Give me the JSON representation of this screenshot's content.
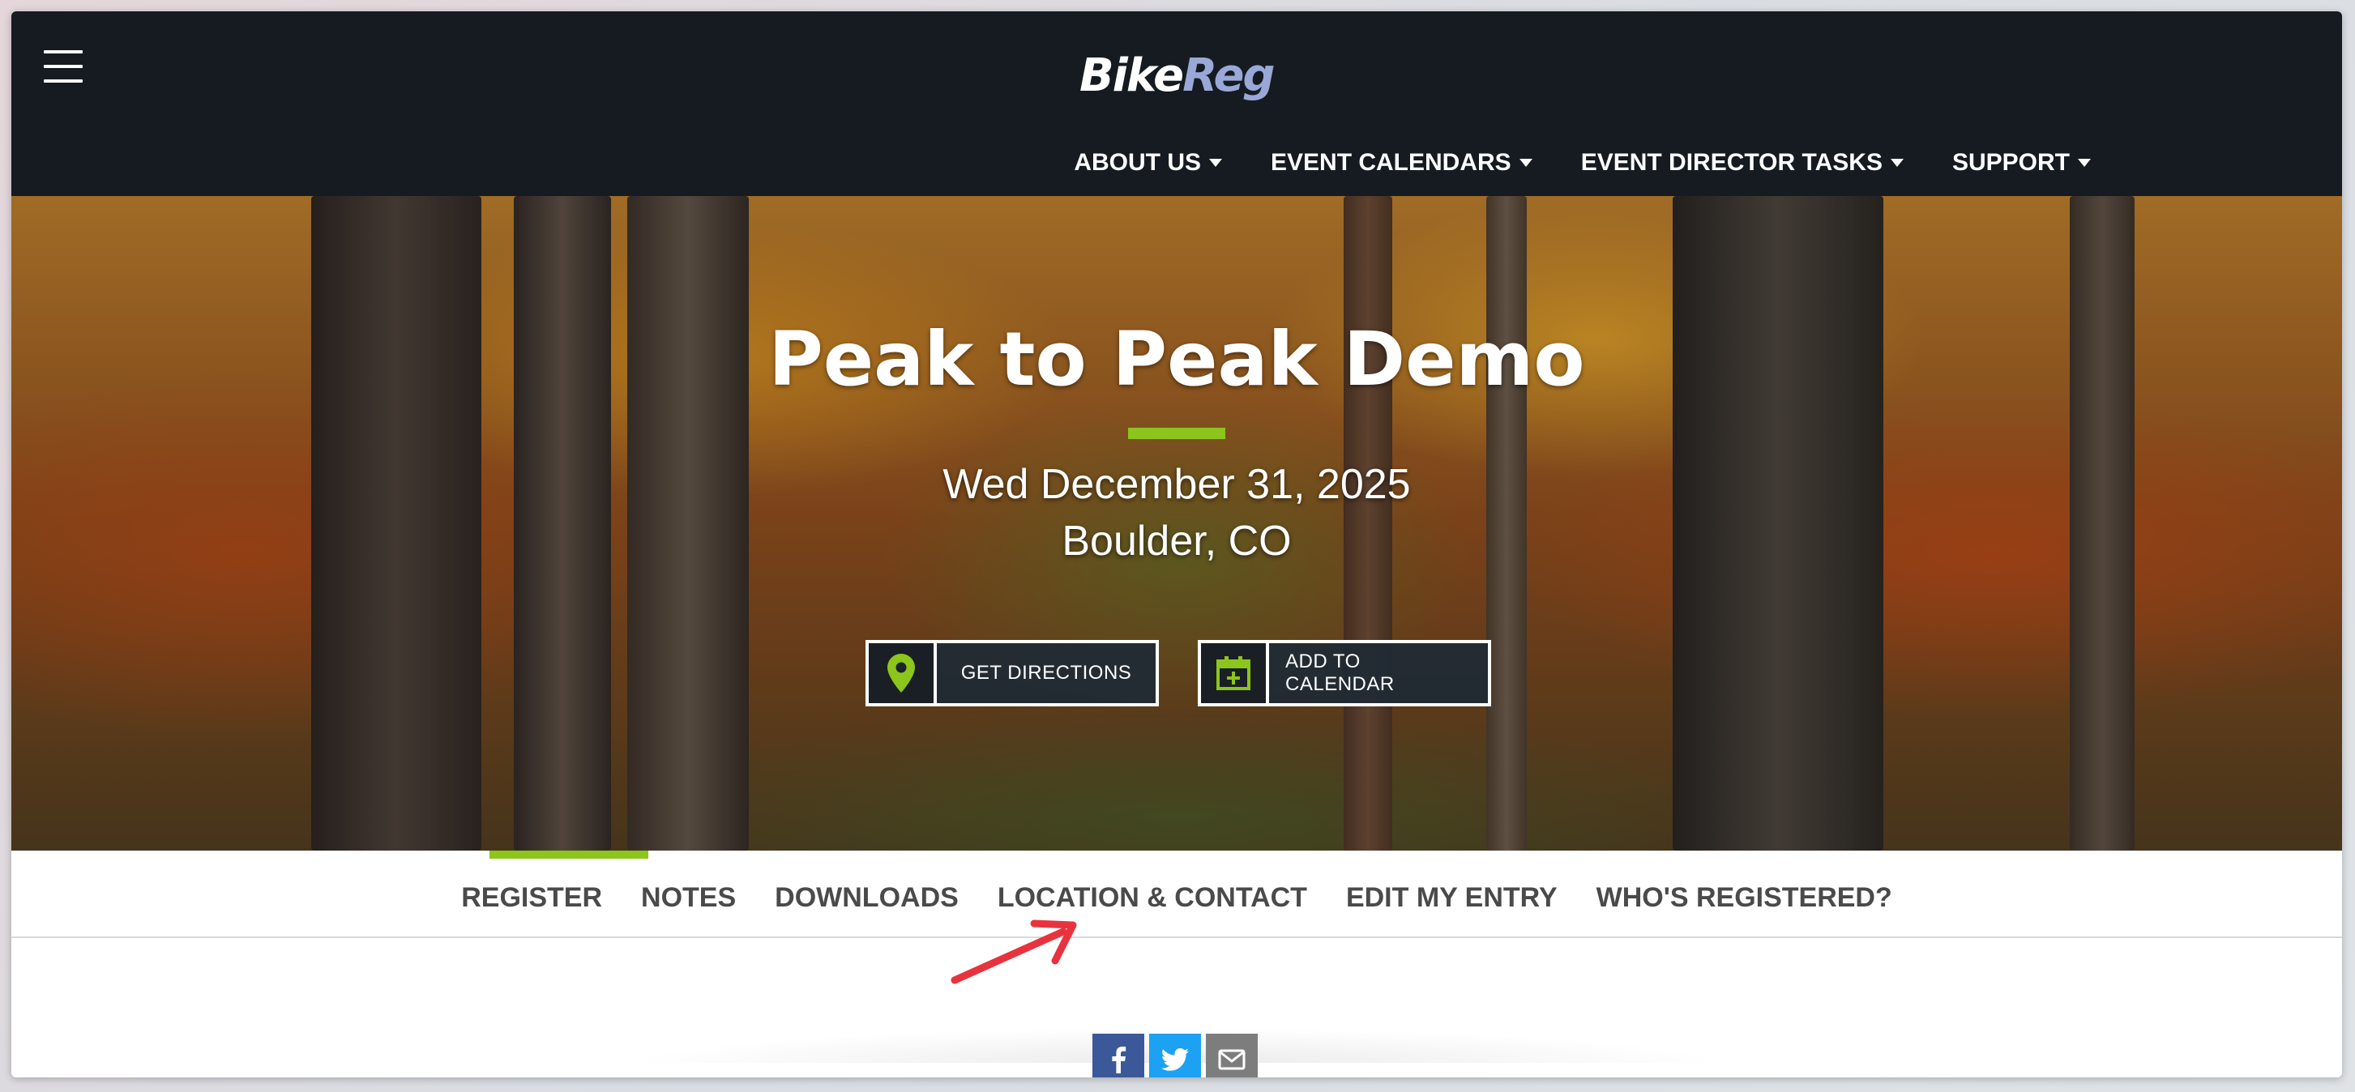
{
  "header": {
    "logo": {
      "part1": "Bike",
      "part2": "Reg"
    },
    "nav": [
      {
        "label": "ABOUT US"
      },
      {
        "label": "EVENT CALENDARS"
      },
      {
        "label": "EVENT DIRECTOR TASKS"
      },
      {
        "label": "SUPPORT"
      }
    ]
  },
  "hero": {
    "title": "Peak to Peak Demo",
    "date": "Wed December 31, 2025",
    "location": "Boulder, CO",
    "buttons": {
      "directions": "GET DIRECTIONS",
      "calendar": "ADD TO CALENDAR"
    }
  },
  "tabs": [
    {
      "label": "REGISTER",
      "active": true
    },
    {
      "label": "NOTES"
    },
    {
      "label": "DOWNLOADS"
    },
    {
      "label": "LOCATION & CONTACT"
    },
    {
      "label": "EDIT MY ENTRY"
    },
    {
      "label": "WHO'S REGISTERED?"
    }
  ],
  "share": [
    {
      "icon": "facebook-icon"
    },
    {
      "icon": "twitter-icon"
    },
    {
      "icon": "email-icon"
    }
  ],
  "colors": {
    "topbar": "#151b20",
    "accent_green": "#8cc51b",
    "annotation_red": "#e8333f",
    "facebook": "#3b5998",
    "twitter": "#1da1f2"
  }
}
